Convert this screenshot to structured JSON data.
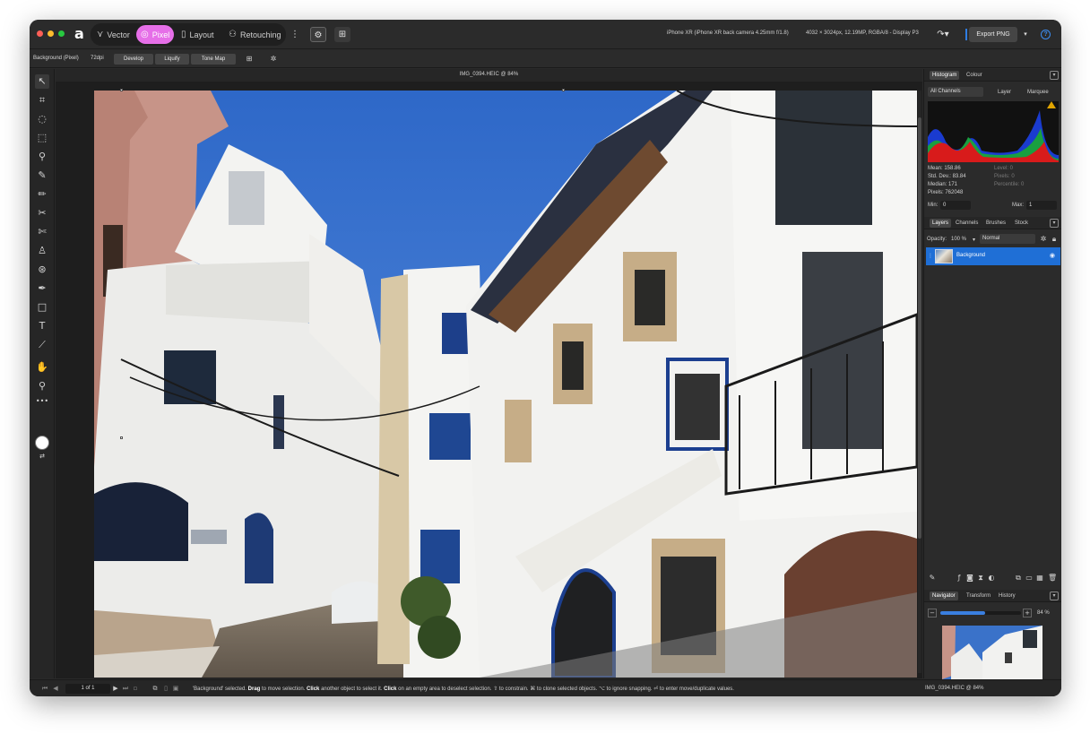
{
  "app": {
    "personas": [
      {
        "label": "Vector",
        "icon": "vector-persona-icon"
      },
      {
        "label": "Pixel",
        "icon": "pixel-persona-icon"
      },
      {
        "label": "Layout",
        "icon": "layout-persona-icon"
      },
      {
        "label": "Retouching",
        "icon": "retouching-persona-icon"
      }
    ],
    "active_persona": "Pixel",
    "accent_color": "#e66fe8",
    "selection_color": "#1f6fd6"
  },
  "topbar": {
    "camera_info": "iPhone XR (iPhone XR back camera 4.25mm f/1.8)",
    "image_info": "4032 × 3024px, 12.19MP, RGBA/8 - Display P3",
    "export_label": "Export PNG",
    "help_label": "?"
  },
  "context": {
    "layer_label": "Background (Pixel)",
    "dpi": "72dpi",
    "buttons": [
      "Develop",
      "Liquify",
      "Tone Map"
    ]
  },
  "document": {
    "title": "IMG_0394.HEIC @ 84%"
  },
  "histogram_panel": {
    "tabs": [
      "Histogram",
      "Colour"
    ],
    "channel": "All Channels",
    "layer_option": "Layer",
    "marquee_option": "Marquee",
    "stats_left": [
      "Mean: 158.86",
      "Std. Dev.: 83.84",
      "Median: 171",
      "Pixels: 762048"
    ],
    "stats_right": [
      "Level: 0",
      "Pixels: 0",
      "Percentile: 0"
    ],
    "min_label": "Min:",
    "min_value": "0",
    "max_label": "Max:",
    "max_value": "1"
  },
  "layers_panel": {
    "tabs": [
      "Layers",
      "Channels",
      "Brushes",
      "Stock"
    ],
    "opacity_label": "Opacity:",
    "opacity_value": "100 %",
    "blend_mode": "Normal",
    "layer_name": "Background"
  },
  "navigator_panel": {
    "tabs": [
      "Navigator",
      "Transform",
      "History"
    ],
    "zoom": "84 %",
    "zoom_fraction": 0.55,
    "footer": "IMG_0394.HEIC @ 84%"
  },
  "status": {
    "page": "1 of 1",
    "hint_prefix": "'Background' selected.",
    "hint_drag": "Drag",
    "hint_1": "to move selection.",
    "hint_click": "Click",
    "hint_2": "another object to select it.",
    "hint_click2": "Click",
    "hint_3": "on an empty area to deselect selection. ⇧ to constrain. ⌘ to clone selected objects. ⌥ to ignore snapping. ⏎ to enter move/duplicate values."
  }
}
